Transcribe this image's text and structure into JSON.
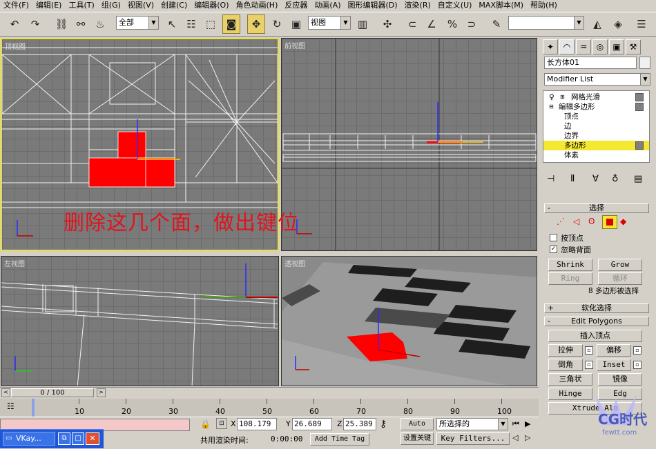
{
  "menu": [
    "文件(F)",
    "编辑(E)",
    "工具(T)",
    "组(G)",
    "视图(V)",
    "创建(C)",
    "编辑器(O)",
    "角色动画(H)",
    "反应器",
    "动画(A)",
    "图形编辑器(D)",
    "渲染(R)",
    "自定义(U)",
    "MAX脚本(M)",
    "帮助(H)"
  ],
  "toolbar": {
    "selection_filter": "全部",
    "reference_coord": "视图",
    "named_selection": ""
  },
  "viewports": {
    "top_label": "顶视图",
    "front_label": "前视图",
    "left_label": "左视图",
    "persp_label": "透视图"
  },
  "annotation": "删除这几个面，做出键位",
  "command_panel": {
    "object_name": "长方体01",
    "modifier_list": "Modifier List",
    "stack": {
      "meshsmooth": "网格光滑",
      "editpoly": "编辑多边形",
      "vertex": "顶点",
      "edge": "边",
      "border": "边界",
      "polygon": "多边形",
      "element": "体素"
    },
    "selection_rollout": "选择",
    "by_vertex": "按顶点",
    "ignore_backfacing": "忽略背面",
    "shrink": "Shrink",
    "grow": "Grow",
    "ring": "Ring",
    "loop": "循环",
    "selection_status": "8 多边形被选择",
    "soft_selection": "软化选择",
    "edit_polygons": "Edit Polygons",
    "insert_vertex": "插入顶点",
    "extrude": "拉伸",
    "offset": "偏移",
    "bevel": "倒角",
    "inset": "Inset",
    "triangulate": "三角状",
    "mirror": "镜像",
    "hinge": "Hinge",
    "edge_btn": "Edg",
    "extrude_along": "Xtrude Alo"
  },
  "time": {
    "frame_display": "0 / 100",
    "ticks": [
      "10",
      "20",
      "30",
      "40",
      "50",
      "60",
      "70",
      "80",
      "90",
      "100"
    ],
    "frame_position": 0
  },
  "status": {
    "x_label": "X",
    "y_label": "Y",
    "z_label": "Z",
    "x": "108.179",
    "y": "26.689",
    "z": "25.389",
    "auto_key": "Auto Key",
    "set_key": "设置关键",
    "selected_option": "所选择的",
    "key_filters": "Key Filters...",
    "render_time_label": "共用渲染时间:",
    "render_time": "0:00:00",
    "add_time_tag": "Add Time Tag"
  },
  "taskbar": {
    "item": "VKay..."
  },
  "watermark": {
    "cn": "CG时代",
    "url": "fewtt.com"
  }
}
